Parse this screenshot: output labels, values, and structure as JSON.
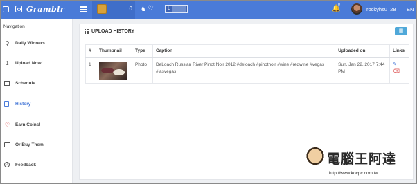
{
  "topbar": {
    "brand": "Gramblr",
    "coins_count": "0",
    "notification_badge": "0",
    "toggle_label": "L",
    "username": "rockyhsu_28",
    "language": "EN",
    "accent_color": "#4a7bd8"
  },
  "sidebar": {
    "heading": "Navigation",
    "items": [
      {
        "label": "Daily Winners",
        "icon": "trophy-icon"
      },
      {
        "label": "Upload Now!",
        "icon": "upload-icon"
      },
      {
        "label": "Schedule",
        "icon": "calendar-icon"
      },
      {
        "label": "History",
        "icon": "history-icon",
        "active": true
      },
      {
        "label": "Earn Coins!",
        "icon": "heart-icon"
      },
      {
        "label": "Or Buy Them",
        "icon": "wallet-icon"
      },
      {
        "label": "Feedback",
        "icon": "help-icon"
      }
    ]
  },
  "panel": {
    "title": "UPLOAD HISTORY"
  },
  "table": {
    "columns": [
      "#",
      "Thumbnail",
      "Type",
      "Caption",
      "Uploaded on",
      "Links"
    ],
    "rows": [
      {
        "num": "1",
        "type": "Photo",
        "caption": "DeLoach Russian River Pinot Noir 2012 #deloach #pinotnoir #wine #redwine #vegas #lasvegas",
        "uploaded_on": "Sun, Jan 22, 2017 7:44 PM"
      }
    ]
  },
  "watermark": {
    "site_cn": "電腦王阿達",
    "url": "http://www.kocpc.com.tw"
  }
}
